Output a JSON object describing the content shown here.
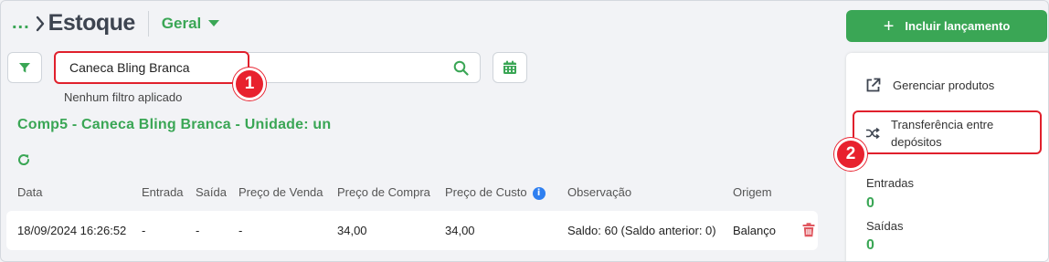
{
  "breadcrumb": {
    "ellipsis": "...",
    "title": "Estoque",
    "selector_label": "Geral"
  },
  "filter": {
    "search_value": "Caneca Bling Branca",
    "status_text": "Nenhum filtro aplicado"
  },
  "product_title": "Comp5 - Caneca Bling Branca - Unidade: un",
  "table": {
    "headers": [
      "Data",
      "Entrada",
      "Saída",
      "Preço de Venda",
      "Preço de Compra",
      "Preço de Custo",
      "Observação",
      "Origem"
    ],
    "rows": [
      [
        "18/09/2024 16:26:52",
        "-",
        "-",
        "-",
        "34,00",
        "34,00",
        "Saldo: 60 (Saldo anterior: 0)",
        "Balanço"
      ]
    ]
  },
  "actions": {
    "add_label": "Incluir lançamento"
  },
  "side_panel": {
    "manage_products": "Gerenciar produtos",
    "transfer": "Transferência entre depósitos",
    "entradas_label": "Entradas",
    "entradas_value": "0",
    "saidas_label": "Saídas",
    "saidas_value": "0"
  },
  "annotations": {
    "badge_1": "1",
    "badge_2": "2"
  },
  "colors": {
    "accent": "#3aa655",
    "highlight": "#e0202c",
    "info": "#2e7ff0",
    "trash": "#e0575f"
  },
  "icons": [
    "chevron-right-icon",
    "caret-down-icon",
    "filter-icon",
    "search-icon",
    "calendar-icon",
    "refresh-icon",
    "info-icon",
    "trash-icon",
    "plus-icon",
    "external-link-icon",
    "shuffle-icon"
  ]
}
